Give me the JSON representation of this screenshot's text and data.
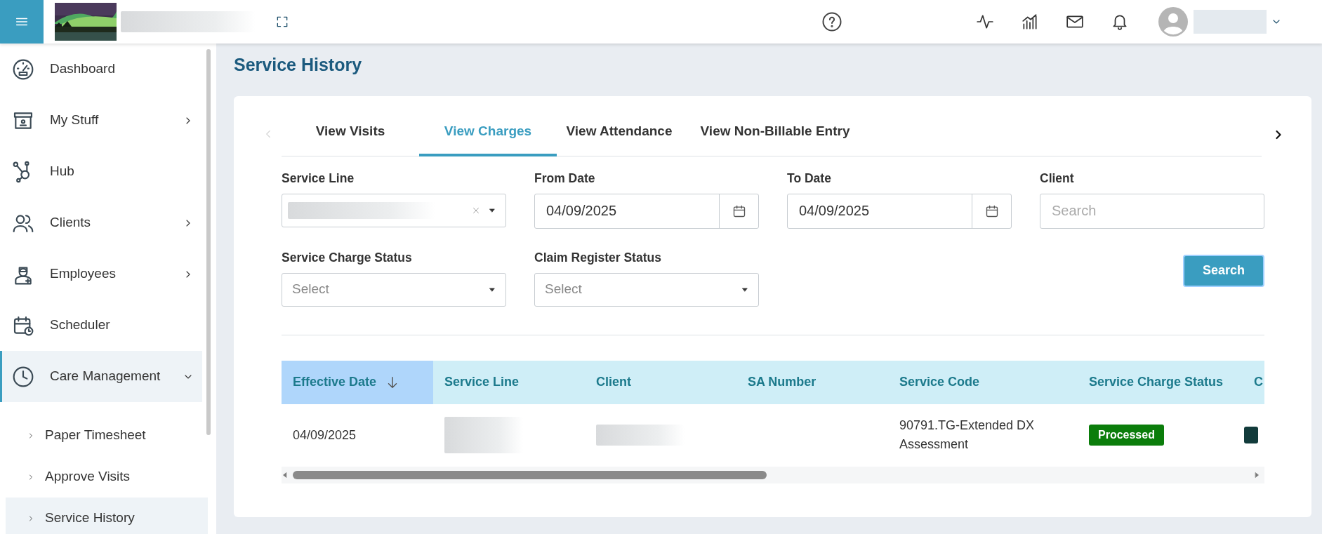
{
  "page": {
    "title": "Service History"
  },
  "sidebar": {
    "items": [
      {
        "label": "Dashboard",
        "kind": "link",
        "selected": false
      },
      {
        "label": "My Stuff",
        "kind": "group",
        "expanded": false,
        "selected": false
      },
      {
        "label": "Hub",
        "kind": "link",
        "selected": false
      },
      {
        "label": "Clients",
        "kind": "group",
        "expanded": false,
        "selected": false
      },
      {
        "label": "Employees",
        "kind": "group",
        "expanded": false,
        "selected": false
      },
      {
        "label": "Scheduler",
        "kind": "link",
        "selected": false
      },
      {
        "label": "Care Management",
        "kind": "group",
        "expanded": true,
        "selected": true,
        "children": [
          {
            "label": "Paper Timesheet",
            "selected": false
          },
          {
            "label": "Approve Visits",
            "selected": false
          },
          {
            "label": "Service History",
            "selected": true
          }
        ]
      }
    ]
  },
  "tabs": {
    "previous": {
      "disabled": true
    },
    "next": {
      "disabled": false
    },
    "items": [
      {
        "label": "View Visits",
        "selected": false
      },
      {
        "label": "View Charges",
        "selected": true
      },
      {
        "label": "View Attendance",
        "selected": false
      },
      {
        "label": "View Non-Billable Entry",
        "selected": false
      }
    ]
  },
  "filters": [
    {
      "label": "Service Line",
      "kind": "select-clearable",
      "redacted": true
    },
    {
      "label": "From Date",
      "kind": "date",
      "value": "04/09/2025"
    },
    {
      "label": "To Date",
      "kind": "date",
      "value": "04/09/2025"
    },
    {
      "label": "Client",
      "kind": "search",
      "placeholder": "Search"
    },
    {
      "label": "Service Charge Status",
      "kind": "select",
      "placeholder": "Select"
    },
    {
      "label": "Claim Register Status",
      "kind": "select",
      "placeholder": "Select"
    }
  ],
  "search_button": "Search",
  "table": {
    "columns": [
      {
        "label": "Effective Date",
        "sorted": true
      },
      {
        "label": "Service Line",
        "sorted": false
      },
      {
        "label": "Client",
        "sorted": false
      },
      {
        "label": "SA Number",
        "sorted": false
      },
      {
        "label": "Service Code",
        "sorted": false
      },
      {
        "label": "Service Charge Status",
        "sorted": false
      },
      {
        "label": "C",
        "sorted": false
      }
    ],
    "rows": [
      {
        "cells": [
          {
            "kind": "text",
            "text": "04/09/2025"
          },
          {
            "kind": "redacted"
          },
          {
            "kind": "redacted"
          },
          {
            "kind": "empty"
          },
          {
            "kind": "text",
            "text": "90791.TG-Extended DX Assessment"
          },
          {
            "kind": "badge",
            "text": "Processed",
            "color": "#0b7d0b"
          },
          {
            "kind": "badge",
            "color": "#123b3b"
          }
        ]
      }
    ]
  }
}
